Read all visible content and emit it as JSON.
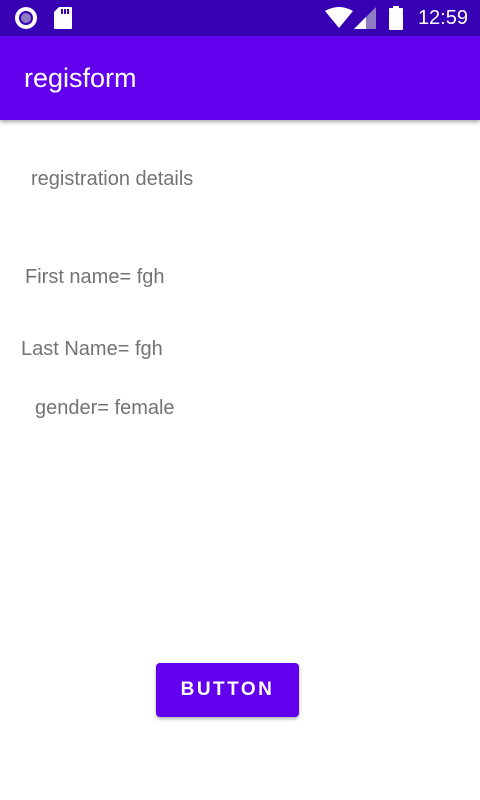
{
  "status_bar": {
    "time": "12:59",
    "icons": [
      "record-icon",
      "sd-card-icon",
      "wifi-icon",
      "cell-signal-icon",
      "battery-icon"
    ]
  },
  "app_bar": {
    "title": "regisform",
    "color": "#6200ee"
  },
  "content": {
    "heading": "registration details",
    "first_name": "First name= fgh",
    "last_name": "Last Name= fgh",
    "gender": "gender= female"
  },
  "button": {
    "label": "BUTTON",
    "color": "#6200ee"
  }
}
